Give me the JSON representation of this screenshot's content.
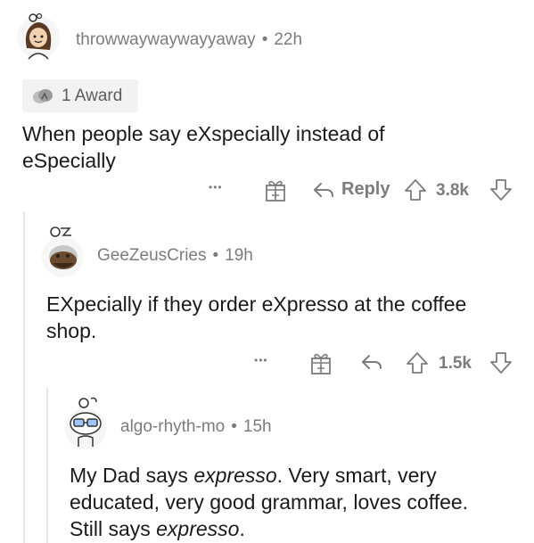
{
  "comments": [
    {
      "username": "throwwaywaywayyaway",
      "age": "22h",
      "award_label": "1 Award",
      "body_lines": [
        "When people say eXspecially instead of",
        "eSpecially"
      ],
      "reply_label": "Reply",
      "score": "3.8k"
    },
    {
      "username": "GeeZeusCries",
      "age": "19h",
      "body_lines": [
        "EXpecially if they order eXpresso at the coffee",
        "shop."
      ],
      "score": "1.5k"
    },
    {
      "username": "algo-rhyth-mo",
      "age": "15h",
      "body_line1_a": "My Dad says ",
      "body_line1_em": "expresso",
      "body_line1_b": ". Very smart, very",
      "body_line2": "educated, very good grammar, loves coffee.",
      "body_line3_a": "Still says ",
      "body_line3_em": "expresso",
      "body_line3_b": "."
    }
  ],
  "separator": "•",
  "more_glyph": "•••",
  "icons": [
    "avatar",
    "award-icon",
    "more-icon",
    "gift-icon",
    "reply-icon",
    "upvote-icon",
    "downvote-icon"
  ]
}
